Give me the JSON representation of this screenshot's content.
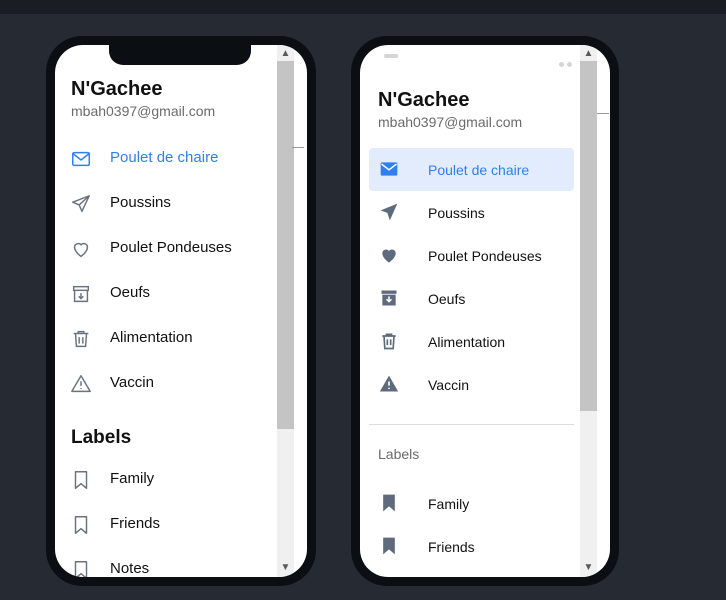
{
  "colors": {
    "accent": "#2f7ff0",
    "active_bg": "#e3ecfd",
    "icon": "#6b7280",
    "background": "#262b33",
    "frame": "#0b0e13"
  },
  "ios_preview": {
    "header": {
      "name": "N'Gachee",
      "email": "mbah0397@gmail.com"
    },
    "menu": [
      {
        "label": "Poulet de chaire",
        "icon": "mail-icon",
        "active": true
      },
      {
        "label": "Poussins",
        "icon": "send-icon",
        "active": false
      },
      {
        "label": "Poulet Pondeuses",
        "icon": "heart-icon",
        "active": false
      },
      {
        "label": "Oeufs",
        "icon": "archive-icon",
        "active": false
      },
      {
        "label": "Alimentation",
        "icon": "trash-icon",
        "active": false
      },
      {
        "label": "Vaccin",
        "icon": "warning-icon",
        "active": false
      }
    ],
    "labels_heading": "Labels",
    "labels": [
      {
        "label": "Family",
        "icon": "bookmark-icon"
      },
      {
        "label": "Friends",
        "icon": "bookmark-icon"
      },
      {
        "label": "Notes",
        "icon": "bookmark-icon"
      }
    ]
  },
  "md_preview": {
    "header": {
      "name": "N'Gachee",
      "email": "mbah0397@gmail.com"
    },
    "menu": [
      {
        "label": "Poulet de chaire",
        "icon": "mail-icon",
        "active": true
      },
      {
        "label": "Poussins",
        "icon": "send-icon",
        "active": false
      },
      {
        "label": "Poulet Pondeuses",
        "icon": "heart-icon",
        "active": false
      },
      {
        "label": "Oeufs",
        "icon": "archive-icon",
        "active": false
      },
      {
        "label": "Alimentation",
        "icon": "trash-icon",
        "active": false
      },
      {
        "label": "Vaccin",
        "icon": "warning-icon",
        "active": false
      }
    ],
    "labels_heading": "Labels",
    "labels": [
      {
        "label": "Family",
        "icon": "bookmark-icon"
      },
      {
        "label": "Friends",
        "icon": "bookmark-icon"
      }
    ]
  }
}
